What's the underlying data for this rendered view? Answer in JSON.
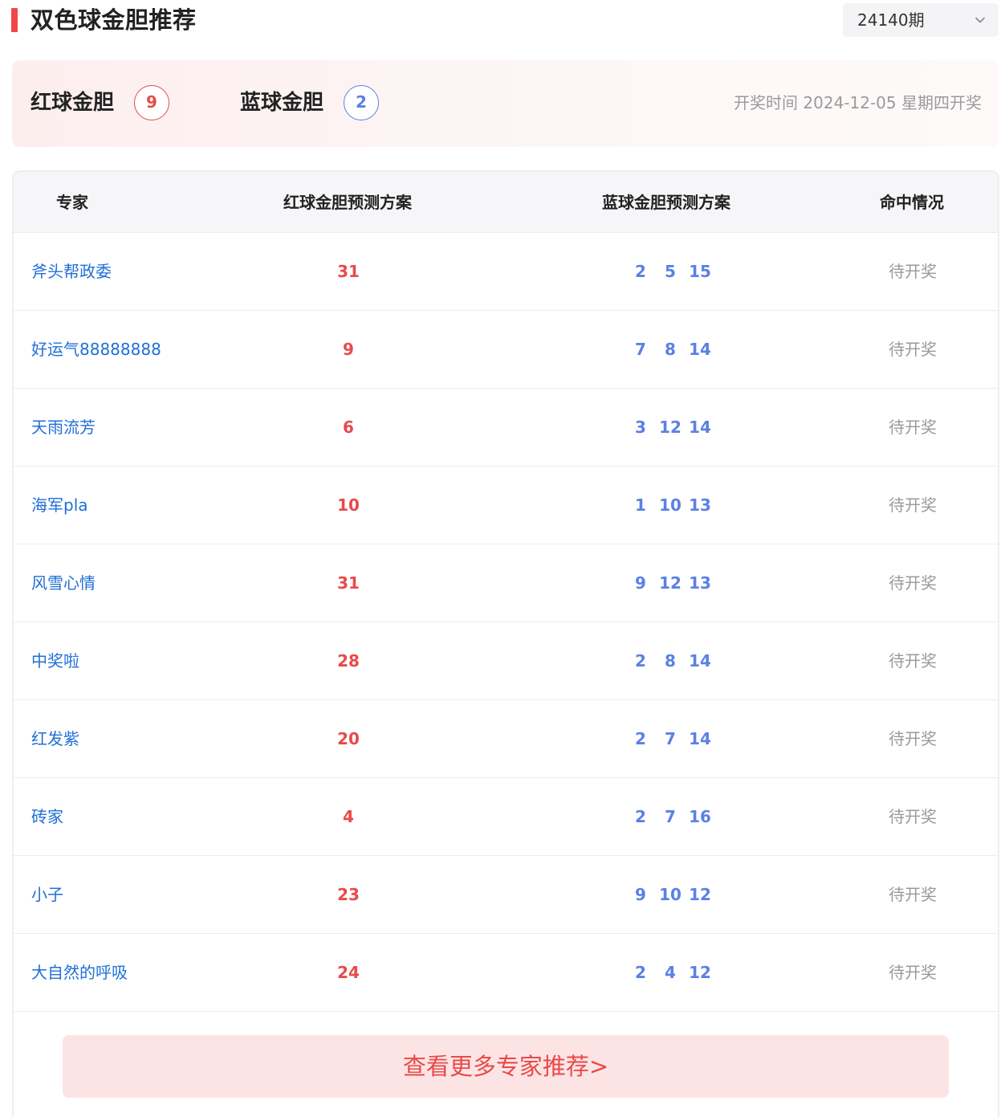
{
  "header": {
    "title": "双色球金胆推荐",
    "issue": "24140期"
  },
  "summary": {
    "red_label": "红球金胆",
    "red_value": "9",
    "blue_label": "蓝球金胆",
    "blue_value": "2",
    "draw_time": "开奖时间 2024-12-05 星期四开奖"
  },
  "table": {
    "columns": [
      "专家",
      "红球金胆预测方案",
      "蓝球金胆预测方案",
      "命中情况"
    ],
    "rows": [
      {
        "expert": "斧头帮政委",
        "red": "31",
        "blue": [
          "2",
          "5",
          "15"
        ],
        "status": "待开奖"
      },
      {
        "expert": "好运气88888888",
        "red": "9",
        "blue": [
          "7",
          "8",
          "14"
        ],
        "status": "待开奖"
      },
      {
        "expert": "天雨流芳",
        "red": "6",
        "blue": [
          "3",
          "12",
          "14"
        ],
        "status": "待开奖"
      },
      {
        "expert": "海军pla",
        "red": "10",
        "blue": [
          "1",
          "10",
          "13"
        ],
        "status": "待开奖"
      },
      {
        "expert": "风雪心情",
        "red": "31",
        "blue": [
          "9",
          "12",
          "13"
        ],
        "status": "待开奖"
      },
      {
        "expert": "中奖啦",
        "red": "28",
        "blue": [
          "2",
          "8",
          "14"
        ],
        "status": "待开奖"
      },
      {
        "expert": "红发紫",
        "red": "20",
        "blue": [
          "2",
          "7",
          "14"
        ],
        "status": "待开奖"
      },
      {
        "expert": "砖家",
        "red": "4",
        "blue": [
          "2",
          "7",
          "16"
        ],
        "status": "待开奖"
      },
      {
        "expert": "小子",
        "red": "23",
        "blue": [
          "9",
          "10",
          "12"
        ],
        "status": "待开奖"
      },
      {
        "expert": "大自然的呼吸",
        "red": "24",
        "blue": [
          "2",
          "4",
          "12"
        ],
        "status": "待开奖"
      }
    ]
  },
  "more_button": "查看更多专家推荐>",
  "colors": {
    "accent_red": "#e84a4a",
    "blue_ball": "#5b80e6",
    "expert_link": "#1f6fd6",
    "status_gray": "#9a9a9a"
  },
  "icons": {
    "title_marker": "title-marker-icon",
    "select_chevron": "chevron-down-icon"
  }
}
